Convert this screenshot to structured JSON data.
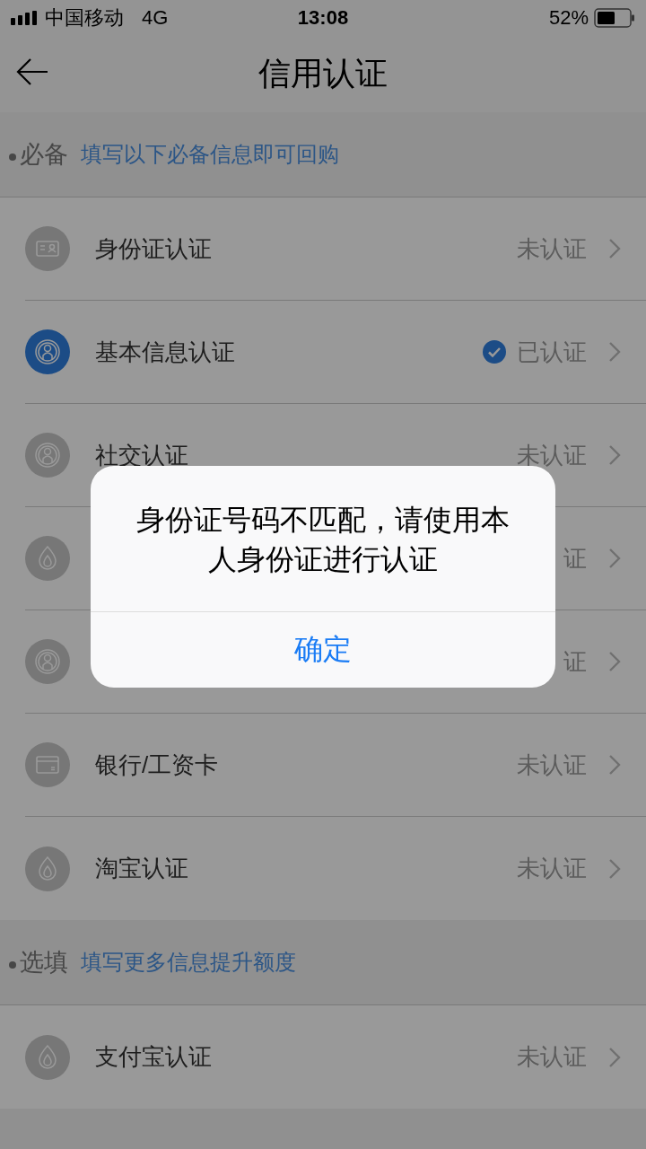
{
  "status_bar": {
    "carrier": "中国移动",
    "network": "4G",
    "time": "13:08",
    "battery": "52%"
  },
  "nav": {
    "title": "信用认证"
  },
  "sections": [
    {
      "title": "必备",
      "hint": "填写以下必备信息即可回购",
      "items": [
        {
          "kind": "id-card",
          "label": "身份证认证",
          "status": "未认证",
          "verified": false
        },
        {
          "kind": "person",
          "label": "基本信息认证",
          "status": "已认证",
          "verified": true
        },
        {
          "kind": "person",
          "label": "社交认证",
          "status": "未认证",
          "verified": false
        },
        {
          "kind": "droplet",
          "status": "证",
          "verified": false
        },
        {
          "kind": "person",
          "status": "证",
          "verified": false
        },
        {
          "kind": "card",
          "label": "银行/工资卡",
          "status": "未认证",
          "verified": false
        },
        {
          "kind": "droplet",
          "label": "淘宝认证",
          "status": "未认证",
          "verified": false
        }
      ]
    },
    {
      "title": "选填",
      "hint": "填写更多信息提升额度",
      "items": [
        {
          "kind": "droplet",
          "label": "支付宝认证",
          "status": "未认证",
          "verified": false
        }
      ]
    }
  ],
  "dialog": {
    "message": "身份证号码不匹配，请使用本人身份证进行认证",
    "button": "确定"
  }
}
